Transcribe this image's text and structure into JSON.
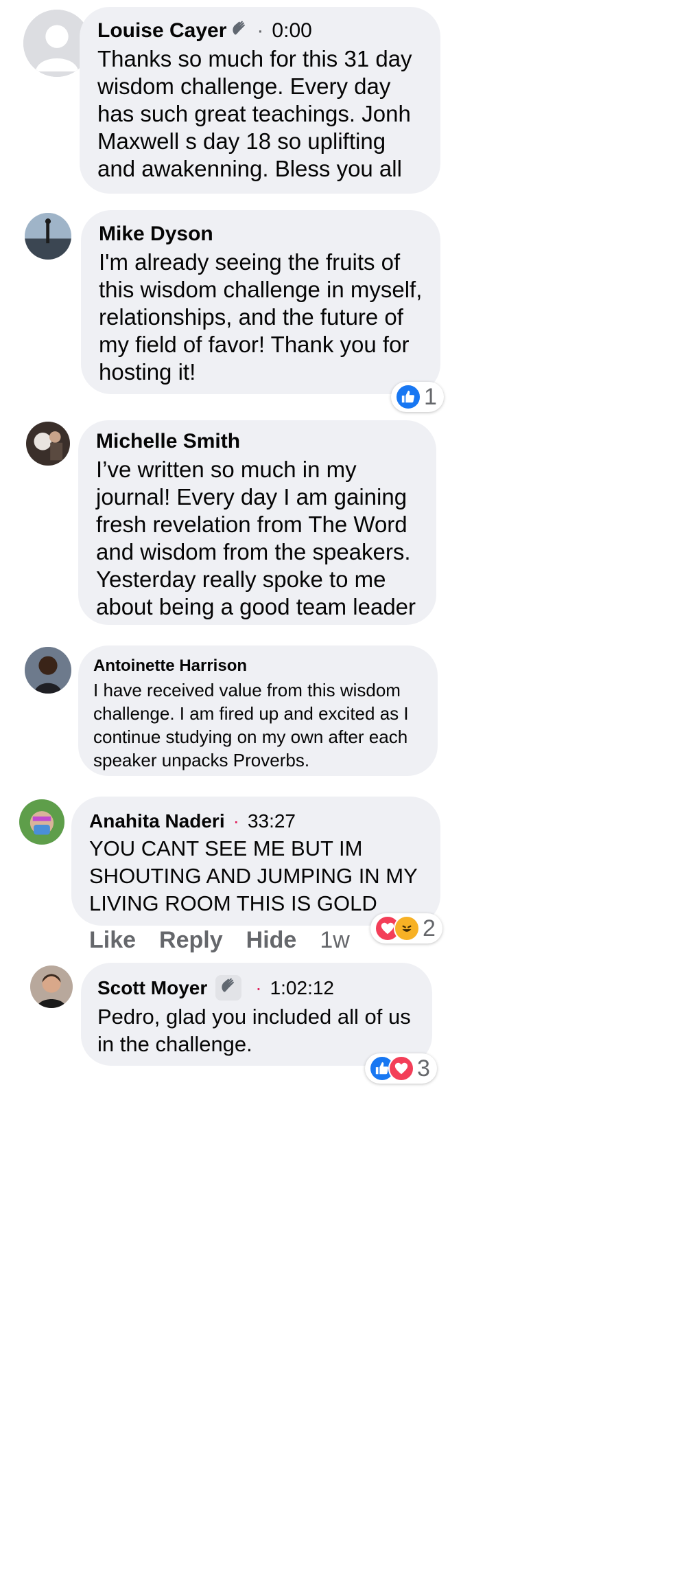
{
  "comments": [
    {
      "name": "Louise Cayer",
      "badge": "wave-icon",
      "time": "0:00",
      "text": "Thanks so much for this 31 day wisdom challenge. Every day has such great teachings. Jonh Maxwell s day 18 so uplifting and awakenning. Bless you all"
    },
    {
      "name": "Mike Dyson",
      "text": "I'm already seeing the fruits of this wisdom challenge in myself, relationships, and the future of my field of favor! Thank you for hosting it!",
      "reaction_count": "1"
    },
    {
      "name": "Michelle Smith",
      "text": "I’ve written so much in my journal! Every day I am gaining fresh revelation from The Word and wisdom from the speakers. Yesterday really spoke to me about being a good team leader"
    },
    {
      "name": "Antoinette Harrison",
      "text": "I have received value from this wisdom challenge.  I am fired up and excited as I continue studying on my own after each speaker unpacks Proverbs."
    },
    {
      "name": "Anahita Naderi",
      "time": "33:27",
      "text": "YOU CANT SEE ME BUT IM SHOUTING AND JUMPING IN MY LIVING ROOM THIS IS GOLD",
      "reaction_count": "2"
    },
    {
      "name": "Scott Moyer",
      "badge": "wave-icon",
      "time": "1:02:12",
      "text": "Pedro, glad you included all of us in the challenge.",
      "reaction_count": "3"
    }
  ],
  "actions": {
    "like": "Like",
    "reply": "Reply",
    "hide": "Hide",
    "ago": "1w"
  },
  "colors": {
    "bubble": "#eff0f4",
    "like": "#1877f2",
    "love": "#f33e58",
    "haha": "#f7b125",
    "dot": "#e0245e"
  }
}
